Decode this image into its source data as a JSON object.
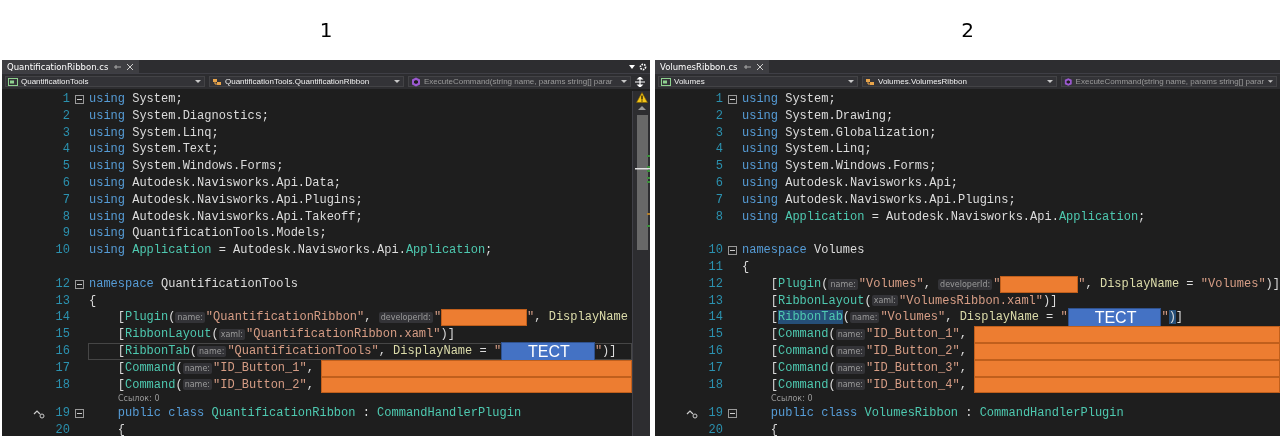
{
  "panes": [
    {
      "number": "1",
      "tab": "QuantificationRibbon.cs",
      "scrollbar": true,
      "nav": [
        {
          "kind": "project",
          "text": "QuantificationTools",
          "dim": false
        },
        {
          "kind": "class",
          "text": "QuantificationTools.QuantificationRibbon",
          "dim": false
        },
        {
          "kind": "method",
          "text": "ExecuteCommand(string name, params string[] parar",
          "dim": true
        }
      ],
      "lines": [
        {
          "kind": "code",
          "n": "1",
          "fold": true,
          "current": false,
          "impl": false,
          "tokens": [
            {
              "kind": "kw",
              "text": "using"
            },
            {
              "kind": "p",
              "text": " System;"
            }
          ]
        },
        {
          "kind": "code",
          "n": "2",
          "fold": false,
          "current": false,
          "impl": false,
          "tokens": [
            {
              "kind": "kw",
              "text": "using"
            },
            {
              "kind": "p",
              "text": " System.Diagnostics;"
            }
          ]
        },
        {
          "kind": "code",
          "n": "3",
          "fold": false,
          "current": false,
          "impl": false,
          "tokens": [
            {
              "kind": "kw",
              "text": "using"
            },
            {
              "kind": "p",
              "text": " System.Linq;"
            }
          ]
        },
        {
          "kind": "code",
          "n": "4",
          "fold": false,
          "current": false,
          "impl": false,
          "tokens": [
            {
              "kind": "kw",
              "text": "using"
            },
            {
              "kind": "p",
              "text": " System.Text;"
            }
          ]
        },
        {
          "kind": "code",
          "n": "5",
          "fold": false,
          "current": false,
          "impl": false,
          "tokens": [
            {
              "kind": "kw",
              "text": "using"
            },
            {
              "kind": "p",
              "text": " System.Windows.Forms;"
            }
          ]
        },
        {
          "kind": "code",
          "n": "6",
          "fold": false,
          "current": false,
          "impl": false,
          "tokens": [
            {
              "kind": "kw",
              "text": "using"
            },
            {
              "kind": "p",
              "text": " Autodesk.Navisworks.Api.Data;"
            }
          ]
        },
        {
          "kind": "code",
          "n": "7",
          "fold": false,
          "current": false,
          "impl": false,
          "tokens": [
            {
              "kind": "kw",
              "text": "using"
            },
            {
              "kind": "p",
              "text": " Autodesk.Navisworks.Api.Plugins;"
            }
          ]
        },
        {
          "kind": "code",
          "n": "8",
          "fold": false,
          "current": false,
          "impl": false,
          "tokens": [
            {
              "kind": "kw",
              "text": "using"
            },
            {
              "kind": "p",
              "text": " Autodesk.Navisworks.Api.Takeoff;"
            }
          ]
        },
        {
          "kind": "code",
          "n": "9",
          "fold": false,
          "current": false,
          "impl": false,
          "tokens": [
            {
              "kind": "kw",
              "text": "using"
            },
            {
              "kind": "p",
              "text": " QuantificationTools.Models;"
            }
          ]
        },
        {
          "kind": "code",
          "n": "10",
          "fold": false,
          "current": false,
          "impl": false,
          "tokens": [
            {
              "kind": "kw",
              "text": "using"
            },
            {
              "kind": "type",
              "text": " Application"
            },
            {
              "kind": "p",
              "text": " = Autodesk.Navisworks.Api."
            },
            {
              "kind": "type",
              "text": "Application"
            },
            {
              "kind": "p",
              "text": ";"
            }
          ]
        },
        {
          "kind": "blank"
        },
        {
          "kind": "code",
          "n": "12",
          "fold": true,
          "current": false,
          "impl": false,
          "tokens": [
            {
              "kind": "kw",
              "text": "namespace"
            },
            {
              "kind": "p",
              "text": " QuantificationTools"
            }
          ]
        },
        {
          "kind": "code",
          "n": "13",
          "fold": false,
          "current": false,
          "impl": false,
          "tokens": [
            {
              "kind": "p",
              "text": "{"
            }
          ]
        },
        {
          "kind": "code",
          "n": "14",
          "fold": false,
          "current": false,
          "impl": false,
          "tokens": [
            {
              "kind": "p",
              "text": "    ["
            },
            {
              "kind": "type",
              "text": "Plugin"
            },
            {
              "kind": "p",
              "text": "("
            },
            {
              "kind": "hint",
              "text": "name:"
            },
            {
              "kind": "str",
              "text": "\"QuantificationRibbon\""
            },
            {
              "kind": "p",
              "text": ", "
            },
            {
              "kind": "hint",
              "text": "developerId:"
            },
            {
              "kind": "str",
              "text": "\""
            },
            {
              "kind": "redact-short"
            },
            {
              "kind": "str",
              "text": "\""
            },
            {
              "kind": "p",
              "text": ", "
            },
            {
              "kind": "mem",
              "text": "DisplayName"
            }
          ]
        },
        {
          "kind": "code",
          "n": "15",
          "fold": false,
          "current": false,
          "impl": false,
          "tokens": [
            {
              "kind": "p",
              "text": "    ["
            },
            {
              "kind": "type",
              "text": "RibbonLayout"
            },
            {
              "kind": "p",
              "text": "("
            },
            {
              "kind": "hint",
              "text": "xaml:"
            },
            {
              "kind": "str",
              "text": "\"QuantificationRibbon.xaml\""
            },
            {
              "kind": "p",
              "text": ")]"
            }
          ]
        },
        {
          "kind": "code",
          "n": "16",
          "fold": false,
          "current": true,
          "impl": false,
          "tokens": [
            {
              "kind": "p",
              "text": "    ["
            },
            {
              "kind": "type",
              "text": "RibbonTab"
            },
            {
              "kind": "p",
              "text": "("
            },
            {
              "kind": "hint",
              "text": "name:"
            },
            {
              "kind": "str",
              "text": "\"QuantificationTools\""
            },
            {
              "kind": "p",
              "text": ", "
            },
            {
              "kind": "mem",
              "text": "DisplayName"
            },
            {
              "kind": "p",
              "text": " = "
            },
            {
              "kind": "str",
              "text": "\""
            },
            {
              "kind": "overlay",
              "text": "TECT"
            },
            {
              "kind": "str",
              "text": "\""
            },
            {
              "kind": "p",
              "text": ")]"
            }
          ]
        },
        {
          "kind": "code",
          "n": "17",
          "fold": false,
          "current": false,
          "impl": false,
          "tokens": [
            {
              "kind": "p",
              "text": "    ["
            },
            {
              "kind": "type",
              "text": "Command"
            },
            {
              "kind": "p",
              "text": "("
            },
            {
              "kind": "hint",
              "text": "name:"
            },
            {
              "kind": "str",
              "text": "\"ID_Button_1\""
            },
            {
              "kind": "p",
              "text": ", "
            },
            {
              "kind": "redact-rest"
            }
          ]
        },
        {
          "kind": "code",
          "n": "18",
          "fold": false,
          "current": false,
          "impl": false,
          "tokens": [
            {
              "kind": "p",
              "text": "    ["
            },
            {
              "kind": "type",
              "text": "Command"
            },
            {
              "kind": "p",
              "text": "("
            },
            {
              "kind": "hint",
              "text": "name:"
            },
            {
              "kind": "str",
              "text": "\"ID_Button_2\""
            },
            {
              "kind": "p",
              "text": ", "
            },
            {
              "kind": "redact-rest"
            }
          ]
        },
        {
          "kind": "codelens",
          "text": "Ссылок: 0"
        },
        {
          "kind": "code",
          "n": "19",
          "fold": true,
          "current": false,
          "impl": true,
          "tokens": [
            {
              "kind": "kw",
              "text": "    public"
            },
            {
              "kind": "kw",
              "text": " class"
            },
            {
              "kind": "type",
              "text": " QuantificationRibbon"
            },
            {
              "kind": "p",
              "text": " : "
            },
            {
              "kind": "type",
              "text": "CommandHandlerPlugin"
            }
          ]
        },
        {
          "kind": "code",
          "n": "20",
          "fold": false,
          "current": false,
          "impl": false,
          "tokens": [
            {
              "kind": "p",
              "text": "    {"
            }
          ]
        }
      ]
    },
    {
      "number": "2",
      "tab": "VolumesRibbon.cs",
      "scrollbar": false,
      "nav": [
        {
          "kind": "project",
          "text": "Volumes",
          "dim": false
        },
        {
          "kind": "class",
          "text": "Volumes.VolumesRibbon",
          "dim": false
        },
        {
          "kind": "method",
          "text": "ExecuteCommand(string name, params string[] parar",
          "dim": true
        }
      ],
      "lines": [
        {
          "kind": "code",
          "n": "1",
          "fold": true,
          "current": false,
          "impl": false,
          "tokens": [
            {
              "kind": "kw",
              "text": "using"
            },
            {
              "kind": "p",
              "text": " System;"
            }
          ]
        },
        {
          "kind": "code",
          "n": "2",
          "fold": false,
          "current": false,
          "impl": false,
          "tokens": [
            {
              "kind": "kw",
              "text": "using"
            },
            {
              "kind": "p",
              "text": " System.Drawing;"
            }
          ]
        },
        {
          "kind": "code",
          "n": "3",
          "fold": false,
          "current": false,
          "impl": false,
          "tokens": [
            {
              "kind": "kw",
              "text": "using"
            },
            {
              "kind": "p",
              "text": " System.Globalization;"
            }
          ]
        },
        {
          "kind": "code",
          "n": "4",
          "fold": false,
          "current": false,
          "impl": false,
          "tokens": [
            {
              "kind": "kw",
              "text": "using"
            },
            {
              "kind": "p",
              "text": " System.Linq;"
            }
          ]
        },
        {
          "kind": "code",
          "n": "5",
          "fold": false,
          "current": false,
          "impl": false,
          "tokens": [
            {
              "kind": "kw",
              "text": "using"
            },
            {
              "kind": "p",
              "text": " System.Windows.Forms;"
            }
          ]
        },
        {
          "kind": "code",
          "n": "6",
          "fold": false,
          "current": false,
          "impl": false,
          "tokens": [
            {
              "kind": "kw",
              "text": "using"
            },
            {
              "kind": "p",
              "text": " Autodesk.Navisworks.Api;"
            }
          ]
        },
        {
          "kind": "code",
          "n": "7",
          "fold": false,
          "current": false,
          "impl": false,
          "tokens": [
            {
              "kind": "kw",
              "text": "using"
            },
            {
              "kind": "p",
              "text": " Autodesk.Navisworks.Api.Plugins;"
            }
          ]
        },
        {
          "kind": "code",
          "n": "8",
          "fold": false,
          "current": false,
          "impl": false,
          "tokens": [
            {
              "kind": "kw",
              "text": "using"
            },
            {
              "kind": "type",
              "text": " Application"
            },
            {
              "kind": "p",
              "text": " = Autodesk.Navisworks.Api."
            },
            {
              "kind": "type",
              "text": "Application"
            },
            {
              "kind": "p",
              "text": ";"
            }
          ]
        },
        {
          "kind": "blank"
        },
        {
          "kind": "code",
          "n": "10",
          "fold": true,
          "current": false,
          "impl": false,
          "tokens": [
            {
              "kind": "kw",
              "text": "namespace"
            },
            {
              "kind": "p",
              "text": " Volumes"
            }
          ]
        },
        {
          "kind": "code",
          "n": "11",
          "fold": false,
          "current": false,
          "impl": false,
          "tokens": [
            {
              "kind": "p",
              "text": "{"
            }
          ]
        },
        {
          "kind": "code",
          "n": "12",
          "fold": false,
          "current": false,
          "impl": false,
          "tokens": [
            {
              "kind": "p",
              "text": "    ["
            },
            {
              "kind": "type",
              "text": "Plugin"
            },
            {
              "kind": "p",
              "text": "("
            },
            {
              "kind": "hint",
              "text": "name:"
            },
            {
              "kind": "str",
              "text": "\"Volumes\""
            },
            {
              "kind": "p",
              "text": ", "
            },
            {
              "kind": "hint",
              "text": "developerId:"
            },
            {
              "kind": "str",
              "text": "\""
            },
            {
              "kind": "redact-short"
            },
            {
              "kind": "str",
              "text": "\""
            },
            {
              "kind": "p",
              "text": ", "
            },
            {
              "kind": "mem",
              "text": "DisplayName"
            },
            {
              "kind": "p",
              "text": " = "
            },
            {
              "kind": "str",
              "text": "\"Volumes\""
            },
            {
              "kind": "p",
              "text": ")]"
            }
          ]
        },
        {
          "kind": "code",
          "n": "13",
          "fold": false,
          "current": false,
          "impl": false,
          "tokens": [
            {
              "kind": "p",
              "text": "    ["
            },
            {
              "kind": "type",
              "text": "RibbonLayout"
            },
            {
              "kind": "p",
              "text": "("
            },
            {
              "kind": "hint",
              "text": "xaml:"
            },
            {
              "kind": "str",
              "text": "\"VolumesRibbon.xaml\""
            },
            {
              "kind": "p",
              "text": ")]"
            }
          ]
        },
        {
          "kind": "code",
          "n": "14",
          "fold": false,
          "current": false,
          "impl": false,
          "tokens": [
            {
              "kind": "p",
              "text": "    ["
            },
            {
              "kind": "type-hl",
              "text": "RibbonTab"
            },
            {
              "kind": "p",
              "text": "("
            },
            {
              "kind": "hint",
              "text": "name:"
            },
            {
              "kind": "str",
              "text": "\"Volumes\""
            },
            {
              "kind": "p",
              "text": ", "
            },
            {
              "kind": "mem",
              "text": "DisplayName"
            },
            {
              "kind": "p",
              "text": " = "
            },
            {
              "kind": "str",
              "text": "\""
            },
            {
              "kind": "overlay",
              "text": "TECT"
            },
            {
              "kind": "str",
              "text": "\""
            },
            {
              "kind": "p-hl",
              "text": ")"
            },
            {
              "kind": "p",
              "text": "]"
            }
          ]
        },
        {
          "kind": "code",
          "n": "15",
          "fold": false,
          "current": false,
          "impl": false,
          "tokens": [
            {
              "kind": "p",
              "text": "    ["
            },
            {
              "kind": "type",
              "text": "Command"
            },
            {
              "kind": "p",
              "text": "("
            },
            {
              "kind": "hint",
              "text": "name:"
            },
            {
              "kind": "str",
              "text": "\"ID_Button_1\""
            },
            {
              "kind": "p",
              "text": ", "
            },
            {
              "kind": "redact-rest"
            }
          ]
        },
        {
          "kind": "code",
          "n": "16",
          "fold": false,
          "current": false,
          "impl": false,
          "tokens": [
            {
              "kind": "p",
              "text": "    ["
            },
            {
              "kind": "type",
              "text": "Command"
            },
            {
              "kind": "p",
              "text": "("
            },
            {
              "kind": "hint",
              "text": "name:"
            },
            {
              "kind": "str",
              "text": "\"ID_Button_2\""
            },
            {
              "kind": "p",
              "text": ", "
            },
            {
              "kind": "redact-rest"
            }
          ]
        },
        {
          "kind": "code",
          "n": "17",
          "fold": false,
          "current": false,
          "impl": false,
          "tokens": [
            {
              "kind": "p",
              "text": "    ["
            },
            {
              "kind": "type",
              "text": "Command"
            },
            {
              "kind": "p",
              "text": "("
            },
            {
              "kind": "hint",
              "text": "name:"
            },
            {
              "kind": "str",
              "text": "\"ID_Button_3\""
            },
            {
              "kind": "p",
              "text": ", "
            },
            {
              "kind": "redact-rest"
            }
          ]
        },
        {
          "kind": "code",
          "n": "18",
          "fold": false,
          "current": false,
          "impl": false,
          "tokens": [
            {
              "kind": "p",
              "text": "    ["
            },
            {
              "kind": "type",
              "text": "Command"
            },
            {
              "kind": "p",
              "text": "("
            },
            {
              "kind": "hint",
              "text": "name:"
            },
            {
              "kind": "str",
              "text": "\"ID_Button_4\""
            },
            {
              "kind": "p",
              "text": ", "
            },
            {
              "kind": "redact-rest"
            }
          ]
        },
        {
          "kind": "codelens",
          "text": "Ссылок: 0"
        },
        {
          "kind": "code",
          "n": "19",
          "fold": true,
          "current": false,
          "impl": true,
          "tokens": [
            {
              "kind": "kw",
              "text": "    public"
            },
            {
              "kind": "kw",
              "text": " class"
            },
            {
              "kind": "type",
              "text": " VolumesRibbon"
            },
            {
              "kind": "p",
              "text": " : "
            },
            {
              "kind": "type",
              "text": "CommandHandlerPlugin"
            }
          ]
        },
        {
          "kind": "code",
          "n": "20",
          "fold": false,
          "current": false,
          "impl": false,
          "tokens": [
            {
              "kind": "p",
              "text": "    {"
            }
          ]
        }
      ]
    }
  ]
}
